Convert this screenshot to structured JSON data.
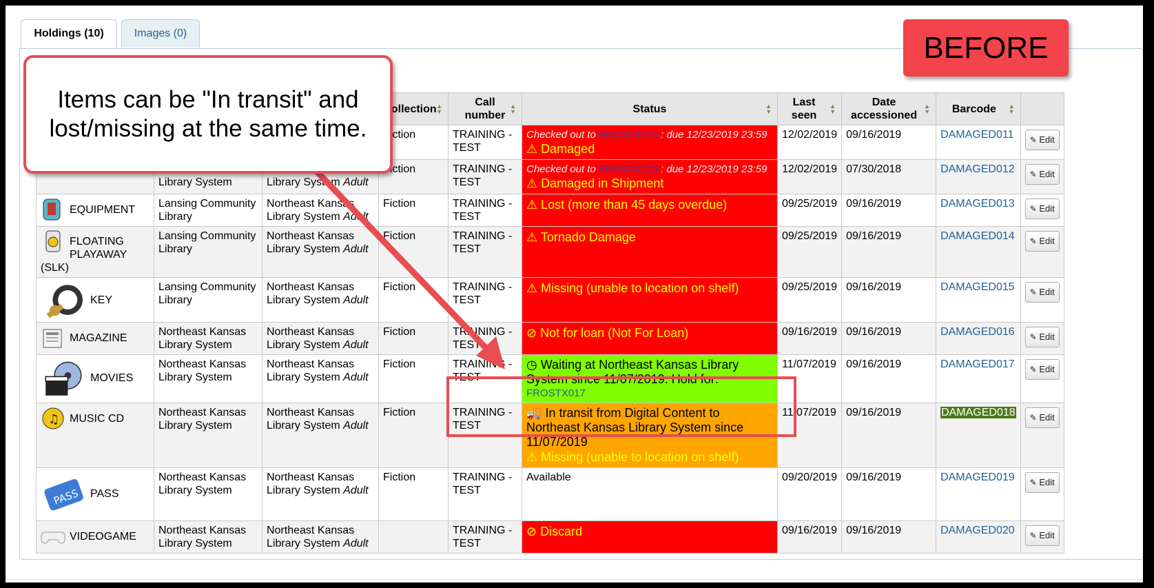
{
  "tabs": [
    {
      "label": "Holdings (10)",
      "active": true
    },
    {
      "label": "Images (0)",
      "active": false
    }
  ],
  "callout_text": "Items can be \"In transit\" and lost/missing at the same time.",
  "badge_text": "BEFORE",
  "columns": {
    "collection": "Collection",
    "call_number": "Call number",
    "status": "Status",
    "last_seen": "Last seen",
    "date_accessioned": "Date accessioned",
    "barcode": "Barcode"
  },
  "edit_label": "Edit",
  "rows": [
    {
      "itype": "",
      "home": "",
      "current": "",
      "current_suffix": "",
      "collection": "Fiction",
      "call": "TRAINING - TEST",
      "checkout_prefix": "Checked out to ",
      "checkout_patron": "FROSTX016",
      "checkout_due": " : due 12/23/2019 23:59",
      "status": "Damaged",
      "last_seen": "12/02/2019",
      "accessioned": "09/16/2019",
      "barcode": "DAMAGED011"
    },
    {
      "itype": "",
      "home": "Library System",
      "current": "Library System",
      "current_suffix": "Adult",
      "collection": "Fiction",
      "call": "TRAINING - TEST",
      "checkout_prefix": "Checked out to ",
      "checkout_patron": "FROSTX016",
      "checkout_due": " : due 12/23/2019 23:59",
      "status": "Damaged in Shipment",
      "last_seen": "12/02/2019",
      "accessioned": "07/30/2018",
      "barcode": "DAMAGED012"
    },
    {
      "itype": "EQUIPMENT",
      "home": "Lansing Community Library",
      "current": "Northeast Kansas Library System",
      "current_suffix": "Adult",
      "collection": "Fiction",
      "call": "TRAINING - TEST",
      "status": "Lost (more than 45 days overdue)",
      "last_seen": "09/25/2019",
      "accessioned": "09/16/2019",
      "barcode": "DAMAGED013"
    },
    {
      "itype": "FLOATING PLAYAWAY (SLK)",
      "home": "Lansing Community Library",
      "current": "Northeast Kansas Library System",
      "current_suffix": "Adult",
      "collection": "Fiction",
      "call": "TRAINING - TEST",
      "status": "Tornado Damage",
      "last_seen": "09/25/2019",
      "accessioned": "09/16/2019",
      "barcode": "DAMAGED014"
    },
    {
      "itype": "KEY",
      "home": "Lansing Community Library",
      "current": "Northeast Kansas Library System",
      "current_suffix": "Adult",
      "collection": "Fiction",
      "call": "TRAINING - TEST",
      "status": "Missing (unable to location on shelf)",
      "last_seen": "09/25/2019",
      "accessioned": "09/16/2019",
      "barcode": "DAMAGED015"
    },
    {
      "itype": "MAGAZINE",
      "home": "Northeast Kansas Library System",
      "current": "Northeast Kansas Library System",
      "current_suffix": "Adult",
      "collection": "Fiction",
      "call": "TRAINING - TEST",
      "status": "Not for loan (Not For Loan)",
      "last_seen": "09/16/2019",
      "accessioned": "09/16/2019",
      "barcode": "DAMAGED016"
    },
    {
      "itype": "MOVIES",
      "home": "Northeast Kansas Library System",
      "current": "Northeast Kansas Library System",
      "current_suffix": "Adult",
      "collection": "Fiction",
      "call": "TRAINING - TEST",
      "status": "Waiting at Northeast Kansas Library System since 11/07/2019. Hold for:",
      "hold_patron": "FROSTX017",
      "last_seen": "11/07/2019",
      "accessioned": "09/16/2019",
      "barcode": "DAMAGED017"
    },
    {
      "itype": "MUSIC CD",
      "home": "Northeast Kansas Library System",
      "current": "Northeast Kansas Library System",
      "current_suffix": "Adult",
      "collection": "Fiction",
      "call": "TRAINING - TEST",
      "status": "In transit from Digital Content to Northeast Kansas Library System since 11/07/2019",
      "status2": "Missing (unable to location on shelf)",
      "last_seen": "11/07/2019",
      "accessioned": "09/16/2019",
      "barcode": "DAMAGED018"
    },
    {
      "itype": "PASS",
      "home": "Northeast Kansas Library System",
      "current": "Northeast Kansas Library System",
      "current_suffix": "Adult",
      "collection": "Fiction",
      "call": "TRAINING - TEST",
      "status": "Available",
      "last_seen": "09/20/2019",
      "accessioned": "09/16/2019",
      "barcode": "DAMAGED019"
    },
    {
      "itype": "VIDEOGAME",
      "home": "Northeast Kansas Library System",
      "current": "Northeast Kansas Library System",
      "current_suffix": "Adult",
      "collection": "",
      "call": "TRAINING - TEST",
      "status": "Discard",
      "last_seen": "09/16/2019",
      "accessioned": "09/16/2019",
      "barcode": "DAMAGED020"
    }
  ],
  "colors": {
    "status_red": "#ff0000",
    "status_green": "#80ff00",
    "status_orange": "#ffa500",
    "callout_border": "#e84d52",
    "badge": "#f2444a"
  }
}
